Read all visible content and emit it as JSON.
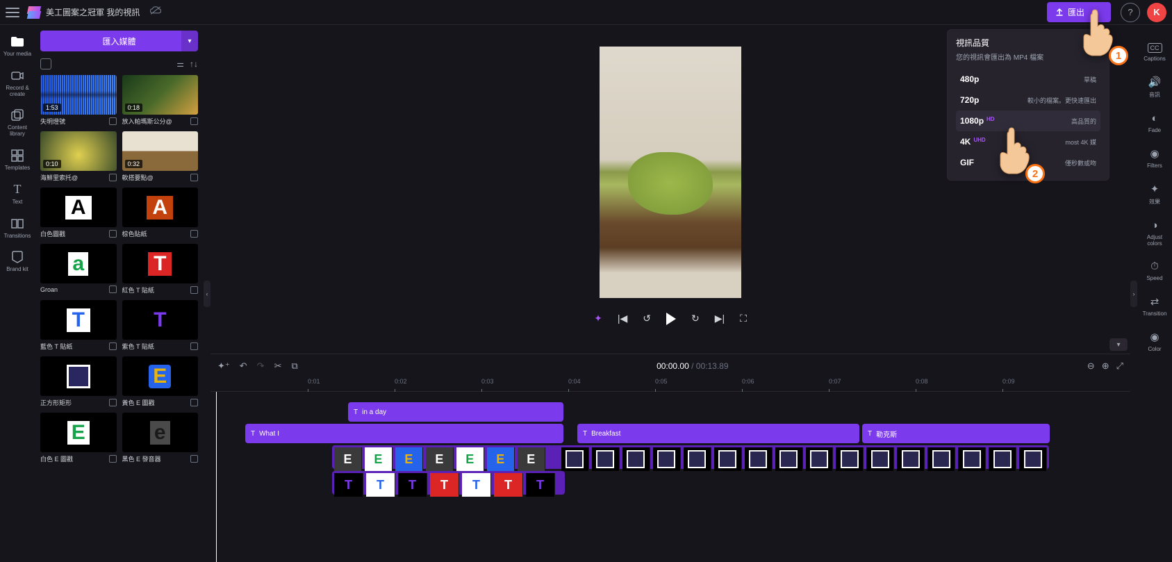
{
  "topbar": {
    "title": "美工圖案之冠軍  我的視訊",
    "export": "匯出",
    "avatar": "K"
  },
  "left_rail": [
    {
      "label": "Your media"
    },
    {
      "label": "Record & create"
    },
    {
      "label": "Content library"
    },
    {
      "label": "Templates"
    },
    {
      "label": "Text"
    },
    {
      "label": "Transitions"
    },
    {
      "label": "Brand kit"
    }
  ],
  "media": {
    "import": "匯入媒體",
    "items": [
      {
        "dur": "1:53",
        "label": "失明燈號"
      },
      {
        "dur": "0:18",
        "label": "放入帕瑪斯公分@"
      },
      {
        "dur": "0:10",
        "label": "海鮮里索托@"
      },
      {
        "dur": "0:32",
        "label": "軟搭要點@"
      },
      {
        "dur": "",
        "label": "白色圖戳"
      },
      {
        "dur": "",
        "label": "棕色貼紙"
      },
      {
        "dur": "",
        "label": "Groan"
      },
      {
        "dur": "",
        "label": "紅色 T 貼紙"
      },
      {
        "dur": "",
        "label": "藍色 T 貼紙"
      },
      {
        "dur": "",
        "label": "紫色 T 貼紙"
      },
      {
        "dur": "",
        "label": "正方形矩形"
      },
      {
        "dur": "",
        "label": "黃色 E 圖戳"
      },
      {
        "dur": "",
        "label": "白色 E 圖戳"
      },
      {
        "dur": "",
        "label": "黑色 E 發音器"
      }
    ]
  },
  "player": {
    "time": "00:00.00",
    "total": "00:13.89"
  },
  "ruler": [
    "0:01",
    "0:02",
    "0:03",
    "0:04",
    "0:05",
    "0:06",
    "0:07",
    "0:08",
    "0:09"
  ],
  "clips": {
    "t1": "in a day",
    "t2": "What I",
    "t3": "Breakfast",
    "t4": "勒克斯"
  },
  "right_rail": [
    {
      "label": "Captions"
    },
    {
      "label": "音訊"
    },
    {
      "label": "Fade"
    },
    {
      "label": "Filters"
    },
    {
      "label": "效果"
    },
    {
      "label": "Adjust colors"
    },
    {
      "label": "Speed"
    },
    {
      "label": "Transition"
    },
    {
      "label": "Color"
    }
  ],
  "export_dd": {
    "title": "視訊品質",
    "sub": "您的視訊會匯出為 MP4 檔案",
    "opts": [
      {
        "res": "480p",
        "badge": "",
        "desc": "草稿"
      },
      {
        "res": "720p",
        "badge": "",
        "desc": "較小的檔案。更快速匯出"
      },
      {
        "res": "1080p",
        "badge": "HD",
        "desc": "高品質的"
      },
      {
        "res": "4K",
        "badge": "UHD",
        "desc": "most 4K 媒"
      },
      {
        "res": "GIF",
        "badge": "",
        "desc": "僅秒數或吻"
      }
    ]
  },
  "badges": {
    "n1": "1",
    "n2": "2"
  }
}
